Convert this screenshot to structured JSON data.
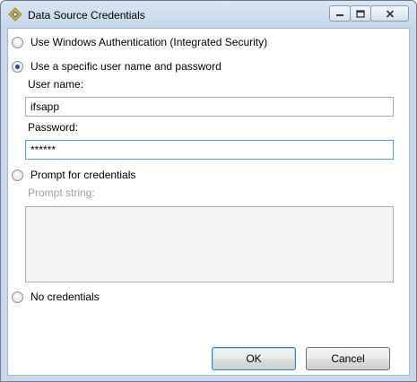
{
  "window": {
    "title": "Data Source Credentials"
  },
  "options": {
    "windows_auth": "Use Windows Authentication (Integrated Security)",
    "specific_user": "Use a specific user name and password",
    "prompt": "Prompt for credentials",
    "none": "No credentials"
  },
  "fields": {
    "username_label": "User name:",
    "username_value": "ifsapp",
    "password_label": "Password:",
    "password_value": "******",
    "prompt_string_label": "Prompt string:",
    "prompt_string_value": ""
  },
  "buttons": {
    "ok": "OK",
    "cancel": "Cancel"
  },
  "selected_option": "specific_user",
  "colors": {
    "accent": "#1b4f9c",
    "focus_border": "#5f9bd6",
    "disabled_text": "#a0a0a0"
  },
  "icons": {
    "app": "data-source-icon",
    "minimize": "minimize-icon",
    "maximize": "maximize-icon",
    "close": "close-icon"
  }
}
